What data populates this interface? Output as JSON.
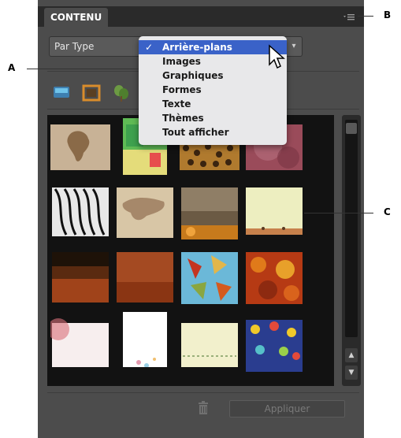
{
  "panel": {
    "tab_label": "CONTENU",
    "menu_icon": "flyout-menu-icon",
    "filter_value": "Par Type",
    "dropdown": {
      "items": [
        {
          "label": "Arrière-plans",
          "checked": true
        },
        {
          "label": "Images",
          "checked": false
        },
        {
          "label": "Graphiques",
          "checked": false
        },
        {
          "label": "Formes",
          "checked": false
        },
        {
          "label": "Texte",
          "checked": false
        },
        {
          "label": "Thèmes",
          "checked": false
        },
        {
          "label": "Tout afficher",
          "checked": false
        }
      ],
      "check_glyph": "✓"
    },
    "view_icons": [
      "backgrounds-icon",
      "frames-icon",
      "graphics-icon"
    ],
    "apply_label": "Appliquer",
    "trash_icon": "trash-icon"
  },
  "callouts": {
    "a": "A",
    "b": "B",
    "c": "C"
  },
  "colors": {
    "panel_bg": "#4c4c4c",
    "title_bg": "#2a2a2a",
    "selected_menu": "#3a62c8",
    "accent_blue": "#4aa7d8",
    "accent_orange": "#d98c2b",
    "accent_green": "#6c9a43"
  }
}
